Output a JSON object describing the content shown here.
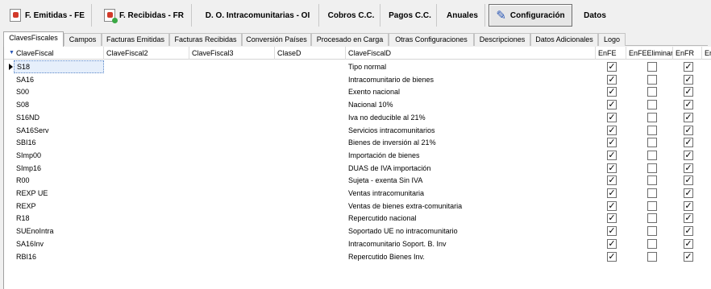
{
  "toolbar": {
    "buttons": [
      {
        "label": "F. Emitidas - FE",
        "icon": "document-red-icon"
      },
      {
        "label": "F. Recibidas - FR",
        "icon": "document-green-icon"
      },
      {
        "label": "D. O. Intracomunitarias - OI"
      },
      {
        "label": "Cobros C.C."
      },
      {
        "label": "Pagos C.C."
      },
      {
        "label": "Anuales"
      },
      {
        "label": "Configuración",
        "icon": "wrench-icon",
        "active": true
      },
      {
        "label": "Datos"
      }
    ]
  },
  "tabs": [
    {
      "label": "ClavesFiscales",
      "active": true
    },
    {
      "label": "Campos"
    },
    {
      "label": "Facturas Emitidas"
    },
    {
      "label": "Facturas Recibidas"
    },
    {
      "label": "Conversión Países"
    },
    {
      "label": "Procesado en Carga"
    },
    {
      "label": "Otras Configuraciones"
    },
    {
      "label": "Descripciones"
    },
    {
      "label": "Datos Adicionales"
    },
    {
      "label": "Logo"
    }
  ],
  "grid": {
    "columns": [
      "ClaveFiscal",
      "ClaveFiscal2",
      "ClaveFiscal3",
      "ClaseD",
      "ClaveFiscalD",
      "EnFE",
      "EnFEEliminar",
      "EnFR",
      "En"
    ],
    "rows": [
      {
        "clave": "S18",
        "desc": "Tipo normal",
        "enfe": true,
        "elim": false,
        "enfr": true
      },
      {
        "clave": "SA16",
        "desc": "Intracomunitario de bienes",
        "enfe": true,
        "elim": false,
        "enfr": true
      },
      {
        "clave": "S00",
        "desc": "Exento nacional",
        "enfe": true,
        "elim": false,
        "enfr": true
      },
      {
        "clave": "S08",
        "desc": "Nacional 10%",
        "enfe": true,
        "elim": false,
        "enfr": true
      },
      {
        "clave": "S16ND",
        "desc": "Iva no deducible al 21%",
        "enfe": true,
        "elim": false,
        "enfr": true
      },
      {
        "clave": "SA16Serv",
        "desc": "Servicios intracomunitarios",
        "enfe": true,
        "elim": false,
        "enfr": true
      },
      {
        "clave": "SBI16",
        "desc": "Bienes de inversión al 21%",
        "enfe": true,
        "elim": false,
        "enfr": true
      },
      {
        "clave": "SImp00",
        "desc": "Importación de bienes",
        "enfe": true,
        "elim": false,
        "enfr": true
      },
      {
        "clave": "SImp16",
        "desc": "DUAS de IVA importación",
        "enfe": true,
        "elim": false,
        "enfr": true
      },
      {
        "clave": "R00",
        "desc": "Sujeta - exenta Sin IVA",
        "enfe": true,
        "elim": false,
        "enfr": true
      },
      {
        "clave": "REXP UE",
        "desc": "Ventas intracomunitaria",
        "enfe": true,
        "elim": false,
        "enfr": true
      },
      {
        "clave": "REXP",
        "desc": "Ventas de bienes extra-comunitaria",
        "enfe": true,
        "elim": false,
        "enfr": true
      },
      {
        "clave": "R18",
        "desc": "Repercutido nacional",
        "enfe": true,
        "elim": false,
        "enfr": true
      },
      {
        "clave": "SUEnoIntra",
        "desc": "Soportado UE no intracomunitario",
        "enfe": true,
        "elim": false,
        "enfr": true
      },
      {
        "clave": "SA16Inv",
        "desc": "Intracomunitario Soport. B. Inv",
        "enfe": true,
        "elim": false,
        "enfr": true
      },
      {
        "clave": "RBI16",
        "desc": "Repercutido Bienes Inv.",
        "enfe": true,
        "elim": false,
        "enfr": true
      }
    ]
  }
}
